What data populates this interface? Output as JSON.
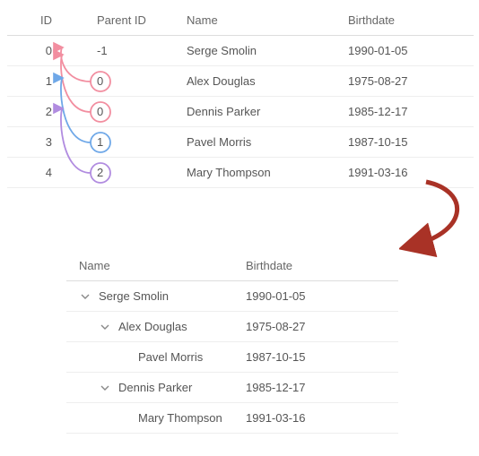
{
  "flat": {
    "headers": {
      "id": "ID",
      "pid": "Parent ID",
      "name": "Name",
      "bd": "Birthdate"
    },
    "rows": [
      {
        "id": "0",
        "pid": "-1",
        "name": "Serge Smolin",
        "bd": "1990-01-05"
      },
      {
        "id": "1",
        "pid": "0",
        "name": "Alex Douglas",
        "bd": "1975-08-27"
      },
      {
        "id": "2",
        "pid": "0",
        "name": "Dennis Parker",
        "bd": "1985-12-17"
      },
      {
        "id": "3",
        "pid": "1",
        "name": "Pavel Morris",
        "bd": "1987-10-15"
      },
      {
        "id": "4",
        "pid": "2",
        "name": "Mary Thompson",
        "bd": "1991-03-16"
      }
    ]
  },
  "tree": {
    "headers": {
      "name": "Name",
      "bd": "Birthdate"
    },
    "rows": [
      {
        "indent": 0,
        "expander": true,
        "name": "Serge Smolin",
        "bd": "1990-01-05"
      },
      {
        "indent": 1,
        "expander": true,
        "name": "Alex Douglas",
        "bd": "1975-08-27"
      },
      {
        "indent": 2,
        "expander": false,
        "name": "Pavel Morris",
        "bd": "1987-10-15"
      },
      {
        "indent": 1,
        "expander": true,
        "name": "Dennis Parker",
        "bd": "1985-12-17"
      },
      {
        "indent": 2,
        "expander": false,
        "name": "Mary Thompson",
        "bd": "1991-03-16"
      }
    ]
  },
  "relations": [
    {
      "from_row": 1,
      "to_row": 0,
      "color": "#f28ea0"
    },
    {
      "from_row": 2,
      "to_row": 0,
      "color": "#f28ea0"
    },
    {
      "from_row": 3,
      "to_row": 1,
      "color": "#6fa8e8"
    },
    {
      "from_row": 4,
      "to_row": 2,
      "color": "#b18ce0"
    }
  ],
  "arrow_color": "#a93226"
}
